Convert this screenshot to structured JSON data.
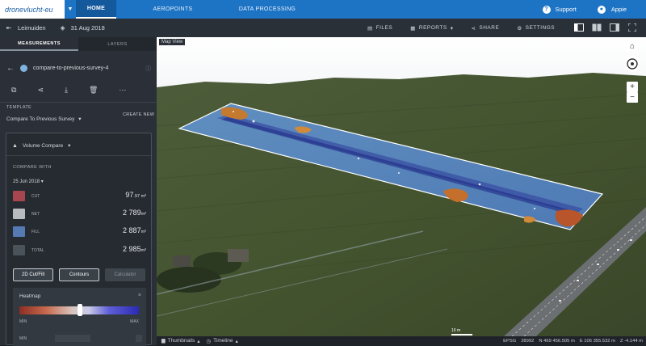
{
  "app": {
    "logo_text": "dronevlucht-eu",
    "nav": [
      "HOME",
      "AEROPOINTS",
      "DATA PROCESSING"
    ],
    "support_label": "Support",
    "user_label": "Appie"
  },
  "subheader": {
    "location": "Leimuiden",
    "date": "31 Aug 2018",
    "files_label": "FILES",
    "reports_label": "REPORTS",
    "share_label": "SHARE",
    "settings_label": "SETTINGS"
  },
  "sidebar": {
    "tabs": [
      "MEASUREMENTS",
      "LAYERS"
    ],
    "measurement_name": "compare-to-previous-survey-4",
    "template_label": "TEMPLATE",
    "template_value": "Compare To Previous Survey",
    "create_new_label": "CREATE NEW",
    "panel_title": "Volume Compare",
    "compare_with_label": "COMPARE WITH",
    "compare_date": "25 Jun 2018",
    "rows": [
      {
        "label": "CUT",
        "main": "97",
        "suffix": ".97 m³",
        "color": "#a8464f"
      },
      {
        "label": "NET",
        "main": "2 789",
        "suffix": "m³",
        "color": "#b9bcbf"
      },
      {
        "label": "FILL",
        "main": "2 887",
        "suffix": "m³",
        "color": "#5579b3"
      },
      {
        "label": "TOTAL",
        "main": "2 985",
        "suffix": "m³",
        "color": "#4a525a"
      }
    ],
    "buttons": {
      "cutfill": "2D Cut/Fill",
      "contours": "Contours",
      "calculator": "Calculator"
    },
    "heatmap_label": "Heatmap",
    "heatmap_min": "MIN",
    "heatmap_max": "MAX",
    "heatmap_min2": "MIN"
  },
  "map": {
    "label": "Map View",
    "scale_label": "10 m",
    "epsg_label": "EPSG",
    "epsg_value": "28992",
    "north": "N  469 456.505 m",
    "east": "E  106 355.532 m",
    "z": "Z  -4.144 m",
    "thumbnails_label": "Thumbnails",
    "timeline_label": "Timeline"
  },
  "colors": {
    "brand": "#1d73c4",
    "cut": "#a8464f",
    "fill": "#5579b3"
  }
}
